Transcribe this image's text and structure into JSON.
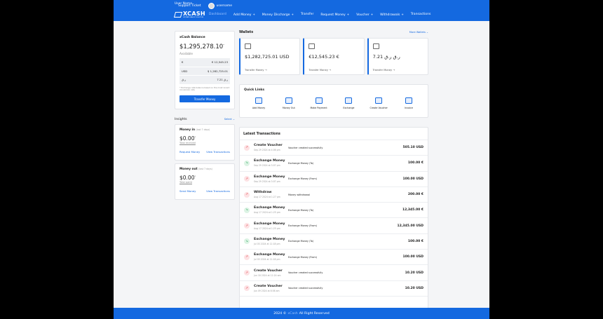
{
  "topbar": {
    "user_name": "User Name",
    "support": "Support Ticket",
    "username": "username"
  },
  "nav": {
    "logo": "XCASH",
    "logo_sub": "ULTIMATE WALLET SOLUTION",
    "items": [
      {
        "label": "Dashboard",
        "plus": ""
      },
      {
        "label": "Add Money",
        "plus": "+"
      },
      {
        "label": "Money Discharge",
        "plus": "+"
      },
      {
        "label": "Transfer",
        "plus": ""
      },
      {
        "label": "Request Money",
        "plus": "+"
      },
      {
        "label": "Voucher",
        "plus": "+"
      },
      {
        "label": "Withdrawals",
        "plus": "+"
      },
      {
        "label": "Transactions",
        "plus": ""
      }
    ]
  },
  "balance": {
    "title": "xCash Balance",
    "amount": "$1,295,278.10",
    "asterisk": "*",
    "available": "Available",
    "rows": [
      {
        "cur": "€",
        "val": "€ 12,545.23"
      },
      {
        "cur": "USD",
        "val": "$ 1,282,725.01"
      },
      {
        "cur": "ر.ق",
        "val": "7.21 ر.ق"
      }
    ],
    "note": "* Exchange rate balance based on the most recent conversion rate",
    "button": "Transfer Money"
  },
  "insights": {
    "title": "Insights",
    "select": "Select ⌄"
  },
  "money_in": {
    "title": "Money in",
    "period": "(last 7 days)",
    "amount": "$0.00",
    "asterisk": "*",
    "sub": "Total received",
    "link1": "Request Money",
    "link2": "View Transactions"
  },
  "money_out": {
    "title": "Money out",
    "period": "(last 7 days)",
    "amount": "$0.00",
    "asterisk": "*",
    "sub": "Total spent",
    "link1": "Send Money",
    "link2": "View Transactions"
  },
  "wallets": {
    "title": "Wallets",
    "more": "More Wallets ⌄",
    "items": [
      {
        "value": "$1,282,725.01 USD",
        "transfer": "Transfer Money  →"
      },
      {
        "value": "€12,545.23 €",
        "transfer": "Transfer Money  →"
      },
      {
        "value": "7.21 ر.ق ر.ق",
        "transfer": "Transfer Money  →"
      }
    ]
  },
  "quick_links": {
    "title": "Quick Links",
    "items": [
      "Add Money",
      "Money Out",
      "Make Payment",
      "Exchange",
      "Create Voucher",
      "Invoice"
    ]
  },
  "transactions": {
    "title": "Latest Transactions",
    "rows": [
      {
        "dir": "out",
        "arrow": "↗",
        "name": "Create Voucher",
        "date": "Sep 29 2024 at 4:06 pm",
        "desc": "Voucher created successfully",
        "amount": "505.10 USD"
      },
      {
        "dir": "in",
        "arrow": "↘",
        "name": "Exchange Money",
        "date": "Sep 29 2024 at 3:07 pm",
        "desc": "Exchange Money (To)",
        "amount": "100.00 €"
      },
      {
        "dir": "out",
        "arrow": "↗",
        "name": "Exchange Money",
        "date": "Sep 29 2024 at 3:07 pm",
        "desc": "Exchange Money (From)",
        "amount": "100.00 USD"
      },
      {
        "dir": "out",
        "arrow": "↗",
        "name": "Withdraw",
        "date": "Aug 17 2024 at 1:27 pm",
        "desc": "Money withdrawal",
        "amount": "200.00 €"
      },
      {
        "dir": "in",
        "arrow": "↘",
        "name": "Exchange Money",
        "date": "Aug 17 2024 at 1:25 pm",
        "desc": "Exchange Money (To)",
        "amount": "12,345.00 €"
      },
      {
        "dir": "out",
        "arrow": "↗",
        "name": "Exchange Money",
        "date": "Aug 17 2024 at 1:25 pm",
        "desc": "Exchange Money (From)",
        "amount": "12,345.00 USD"
      },
      {
        "dir": "in",
        "arrow": "↘",
        "name": "Exchange Money",
        "date": "Jul 03 2024 at 11:18 pm",
        "desc": "Exchange Money (To)",
        "amount": "100.00 €"
      },
      {
        "dir": "out",
        "arrow": "↗",
        "name": "Exchange Money",
        "date": "Jul 03 2024 at 11:18 pm",
        "desc": "Exchange Money (From)",
        "amount": "100.00 USD"
      },
      {
        "dir": "out",
        "arrow": "↗",
        "name": "Create Voucher",
        "date": "Jun 18 2024 at 11:24 am",
        "desc": "Voucher created successfully",
        "amount": "10.20 USD"
      },
      {
        "dir": "out",
        "arrow": "↗",
        "name": "Create Voucher",
        "date": "Jun 09 2024 at 8:58 am",
        "desc": "Voucher created successfully",
        "amount": "10.20 USD"
      }
    ]
  },
  "footer": {
    "year": "2024 ©",
    "brand": "xCash",
    "rights": "All Right Reserved"
  },
  "colors": {
    "primary": "#1469e0",
    "negative": "#e0464f",
    "positive": "#2aa35b"
  }
}
